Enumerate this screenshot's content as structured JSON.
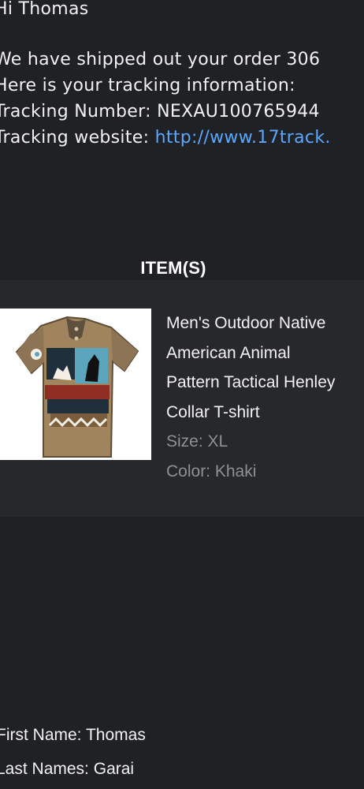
{
  "message": {
    "greeting": "Hi Thomas",
    "shipped_line": "We have shipped out your order 306",
    "tracking_intro": "Here is your tracking information:",
    "tracking_number_label": "Tracking Number:",
    "tracking_number": "NEXAU100765944",
    "tracking_website_label": "Tracking website:",
    "tracking_website": "http://www.17track."
  },
  "items_section": {
    "title": "ITEM(S)",
    "items": [
      {
        "name_lines": [
          "Men's Outdoor Native",
          "American Animal",
          "Pattern Tactical Henley",
          "Collar T-shirt"
        ],
        "size_label": "Size:",
        "size": "XL",
        "color_label": "Color:",
        "color": "Khaki",
        "image": {
          "icon": "henley-t-shirt-product-photo",
          "colors": [
            "#a0845e",
            "#1f2f3b",
            "#5ba6bd",
            "#8f2e23",
            "#f4eee4"
          ]
        }
      }
    ]
  },
  "customer": {
    "first_name_label": "First Name:",
    "first_name": "Thomas",
    "last_name_label": "Last Names:",
    "last_name": "Garai"
  },
  "theme": {
    "background": "#202124",
    "panel": "#27282c",
    "text": "#f2f2f2",
    "muted": "#8f9094",
    "link": "#5aa7ff"
  }
}
